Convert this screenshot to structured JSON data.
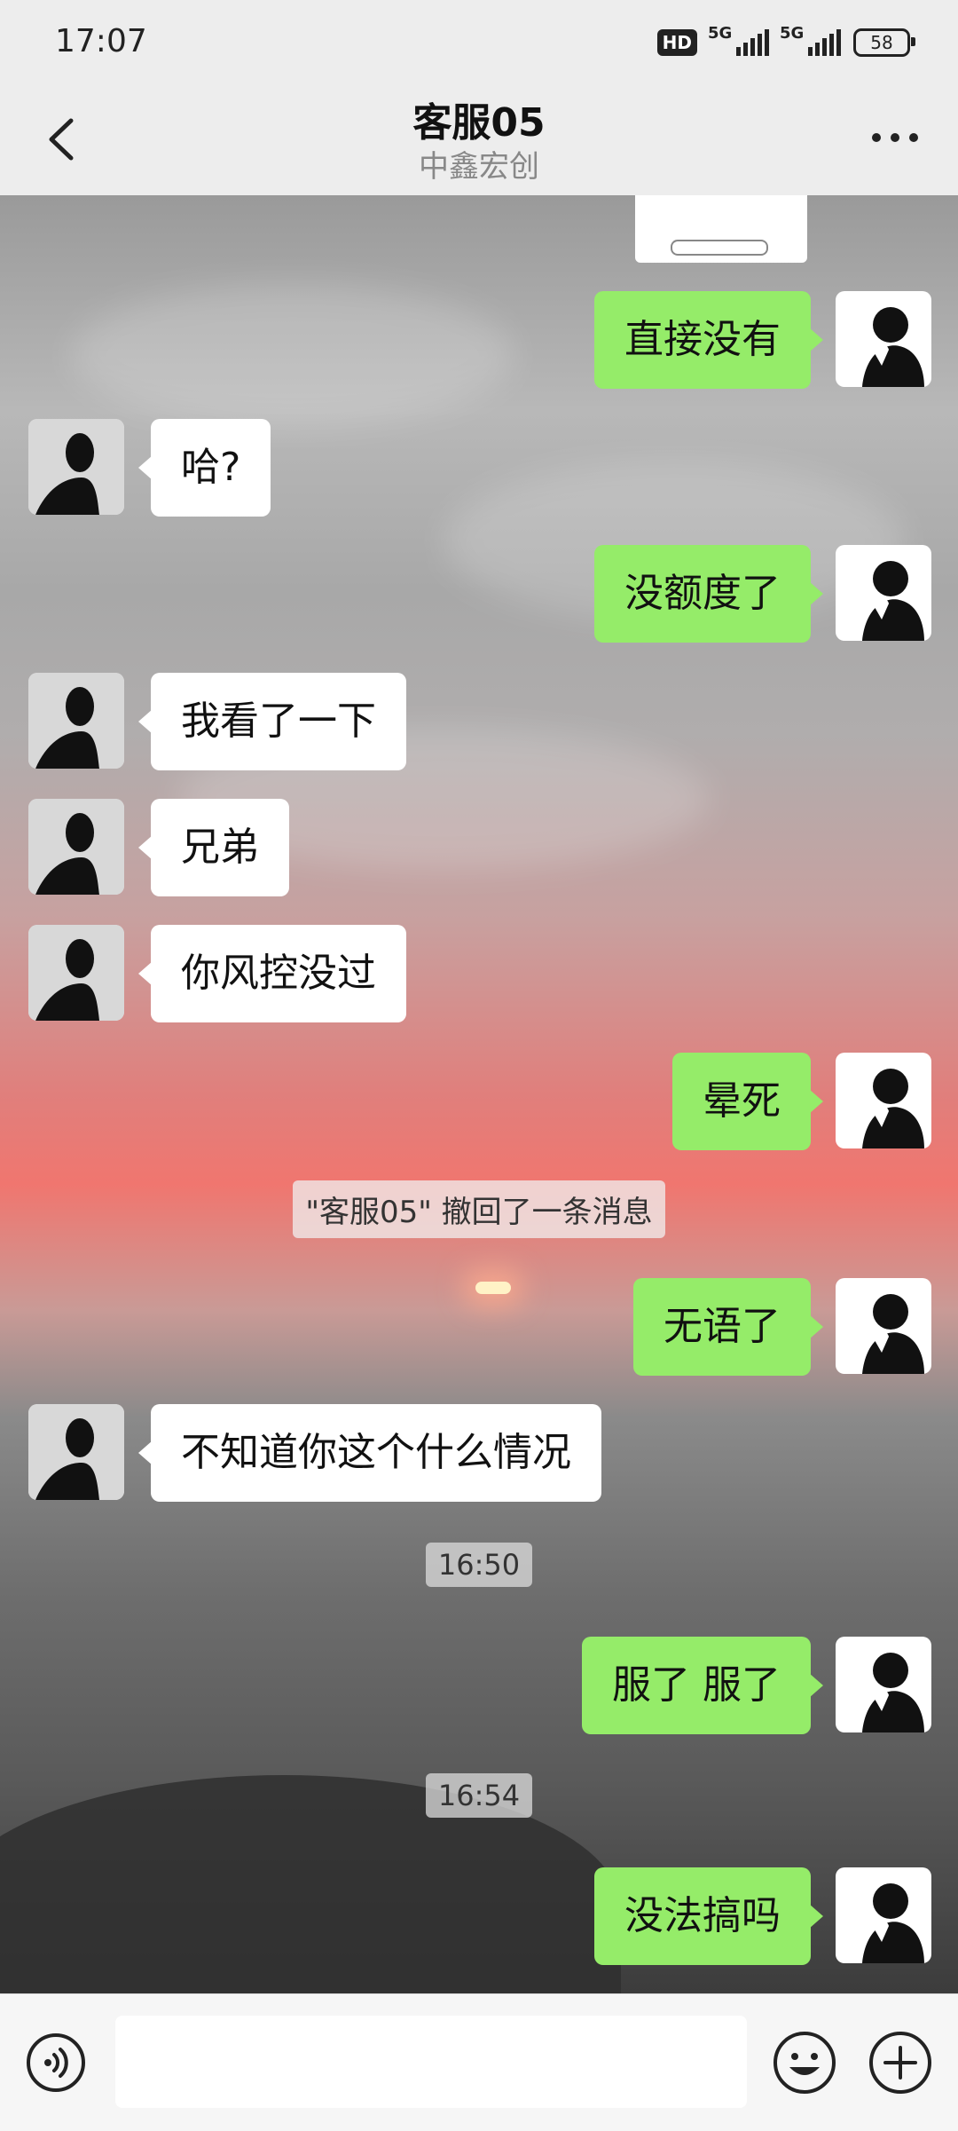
{
  "status_bar": {
    "time": "17:07",
    "hd": "HD",
    "net1": "5G",
    "net2": "5G",
    "battery": "58"
  },
  "nav": {
    "title": "客服05",
    "subtitle": "中鑫宏创"
  },
  "messages": [
    {
      "side": "me",
      "text": "直接没有"
    },
    {
      "side": "them",
      "text": "哈?"
    },
    {
      "side": "me",
      "text": "没额度了"
    },
    {
      "side": "them",
      "text": "我看了一下"
    },
    {
      "side": "them",
      "text": "兄弟"
    },
    {
      "side": "them",
      "text": "你风控没过"
    },
    {
      "side": "me",
      "text": "晕死"
    },
    {
      "side": "system",
      "text": "\"客服05\" 撤回了一条消息"
    },
    {
      "side": "me",
      "text": "无语了"
    },
    {
      "side": "them",
      "text": "不知道你这个什么情况"
    },
    {
      "side": "time",
      "text": "16:50"
    },
    {
      "side": "me",
      "text": "服了 服了"
    },
    {
      "side": "time",
      "text": "16:54"
    },
    {
      "side": "me",
      "text": "没法搞吗"
    }
  ],
  "colors": {
    "my_bubble": "#95ec69",
    "their_bubble": "#ffffff",
    "bar_background": "#ededed"
  },
  "icons": {
    "back": "chevron-left-icon",
    "more": "more-dots-icon",
    "voice": "voice-icon",
    "emoji": "emoji-icon",
    "plus": "plus-icon"
  }
}
